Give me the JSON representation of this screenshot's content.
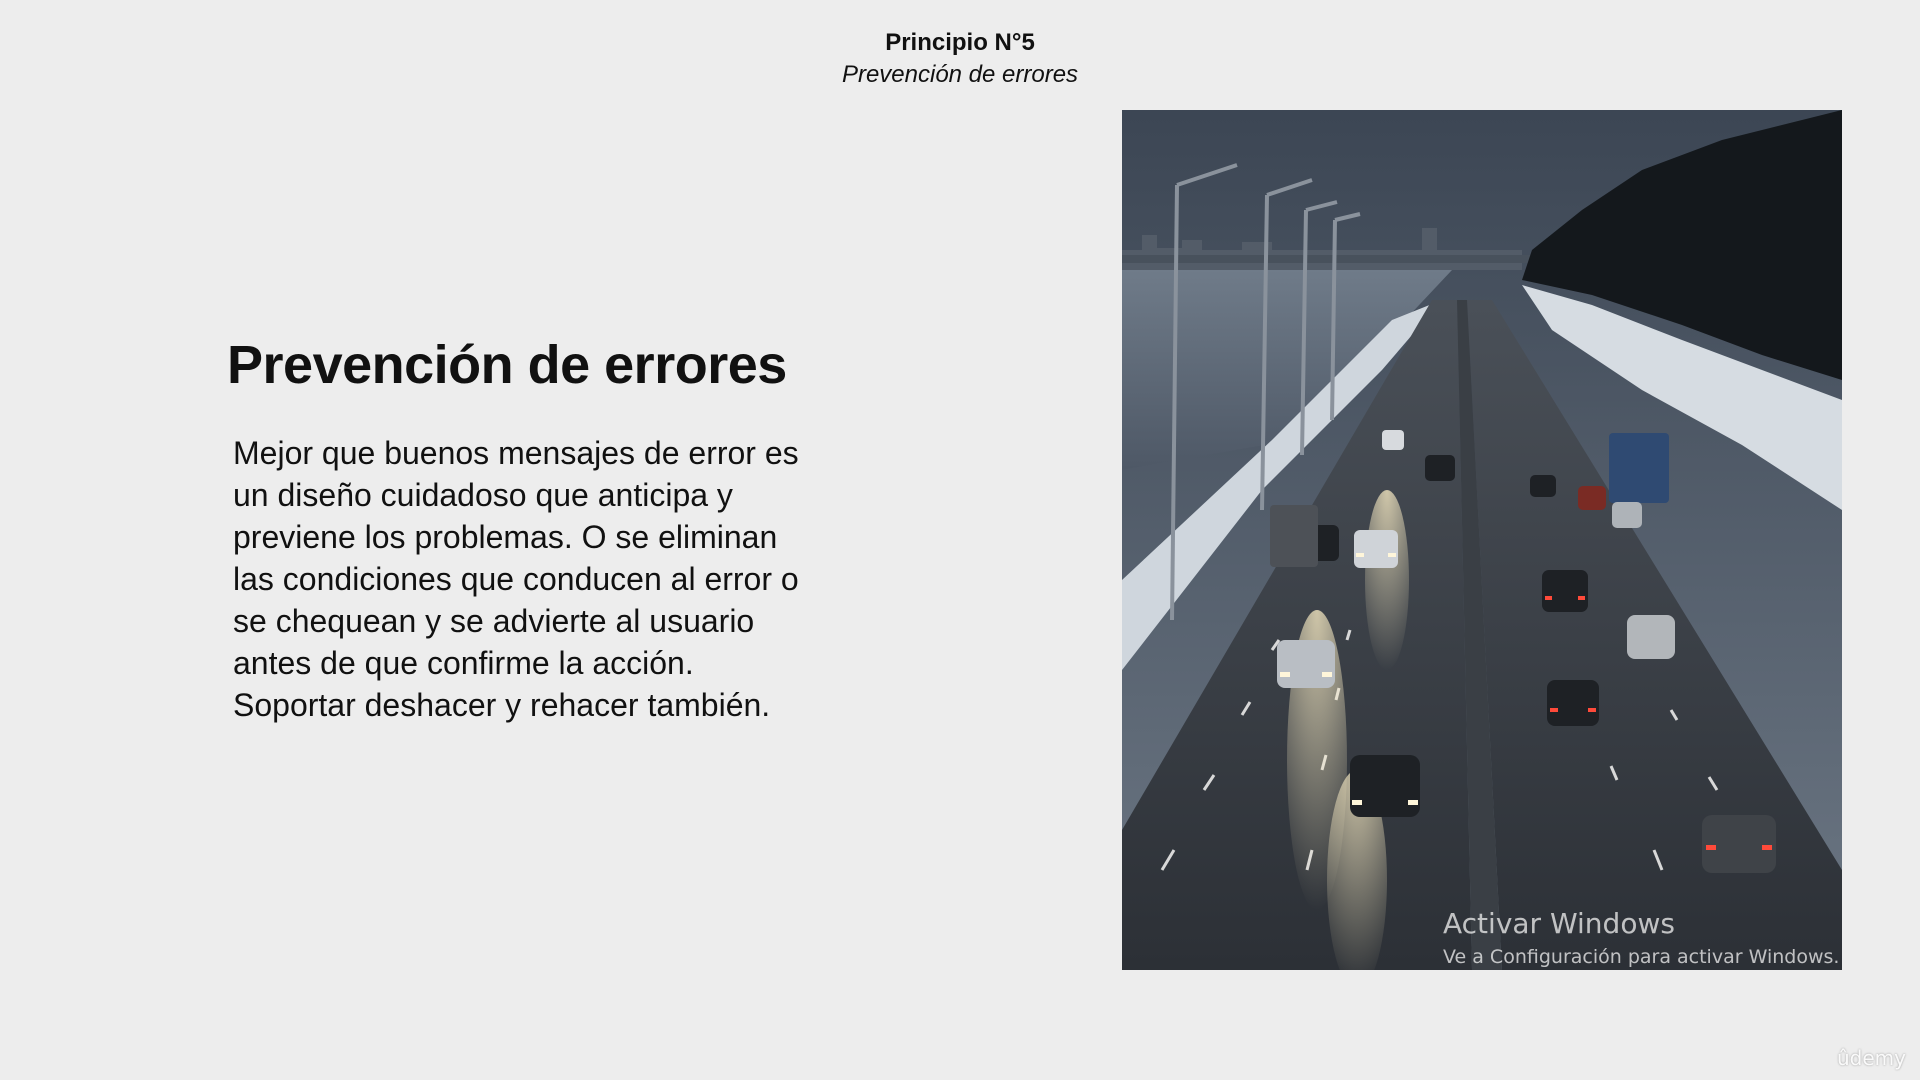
{
  "header": {
    "title": "Principio N°5",
    "subtitle": "Prevención de errores"
  },
  "heading": "Prevención de errores",
  "body_lines": [
    "Mejor que buenos mensajes de error es",
    "un diseño cuidadoso que anticipa y",
    "previene los problemas. O se eliminan",
    "las condiciones que conducen al error o",
    "se chequean y se advierte al usuario",
    "antes de que confirme la acción.",
    "Soportar deshacer y rehacer también."
  ],
  "watermark": {
    "title": "Activar Windows",
    "subtitle": "Ve a Configuración para activar Windows."
  },
  "brand": "ûdemy"
}
